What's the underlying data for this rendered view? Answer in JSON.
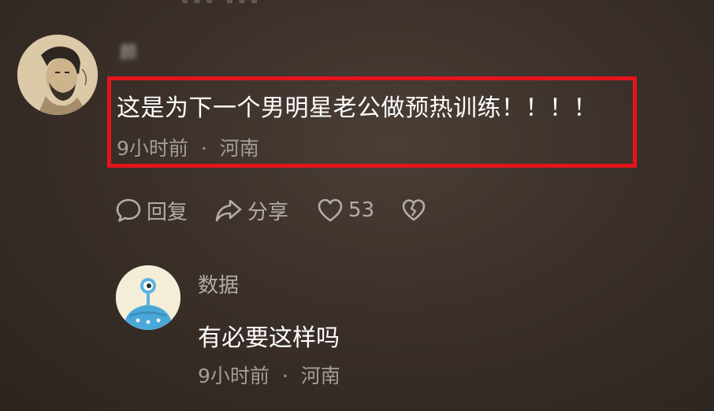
{
  "main_comment": {
    "username": "颜",
    "text": "这是为下一个男明星老公做预热训练！！！！",
    "time": "9小时前",
    "separator": "·",
    "location": "河南",
    "reply_label": "回复",
    "share_label": "分享",
    "like_count": "53"
  },
  "reply_comment": {
    "username": "数据",
    "text": "有必要这样吗",
    "time": "9小时前",
    "separator": "·",
    "location": "河南"
  },
  "icons": {
    "reply": "comment-bubble-icon",
    "share": "share-arrow-icon",
    "like": "heart-icon",
    "dislike": "broken-heart-icon"
  },
  "colors": {
    "highlight_border": "#e4141c",
    "background": "#3b3029",
    "primary_text": "#ffffff",
    "secondary_text": "#a59d97"
  }
}
